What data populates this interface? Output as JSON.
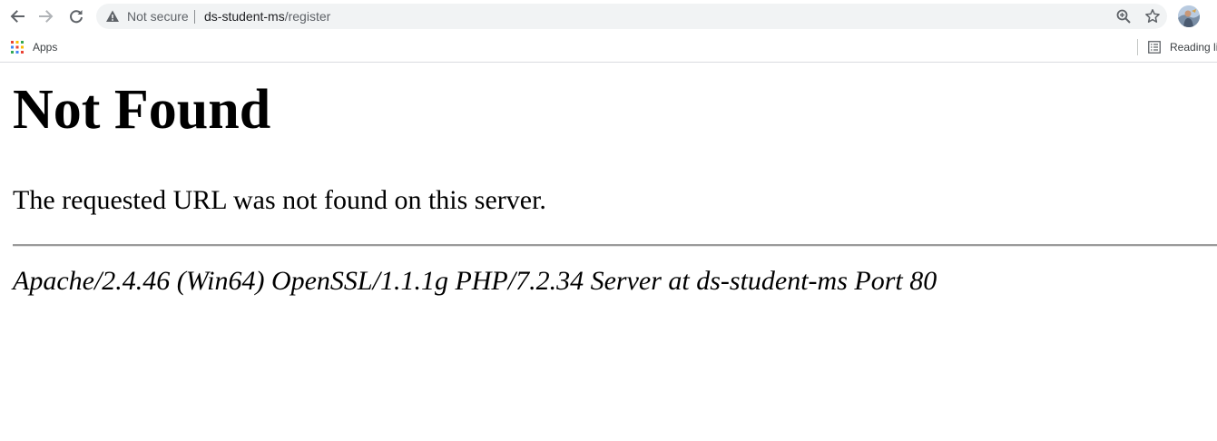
{
  "browser": {
    "omnibox": {
      "security_label": "Not secure",
      "url_host": "ds-student-ms",
      "url_path": "/register"
    },
    "icons": {
      "back": "back-arrow-icon",
      "forward": "forward-arrow-icon",
      "reload": "reload-icon",
      "warning": "warning-icon",
      "zoom": "zoom-icon",
      "bookmark_star": "star-icon",
      "profile": "avatar"
    }
  },
  "bookmarks_bar": {
    "apps_label": "Apps",
    "reading_list_label": "Reading li"
  },
  "page": {
    "heading": "Not Found",
    "message": "The requested URL was not found on this server.",
    "server_signature": "Apache/2.4.46 (Win64) OpenSSL/1.1.1g PHP/7.2.34 Server at ds-student-ms Port 80"
  },
  "colors": {
    "omnibox_bg": "#f1f3f4",
    "toolbar_icon": "#5f6368",
    "text": "#000000"
  }
}
